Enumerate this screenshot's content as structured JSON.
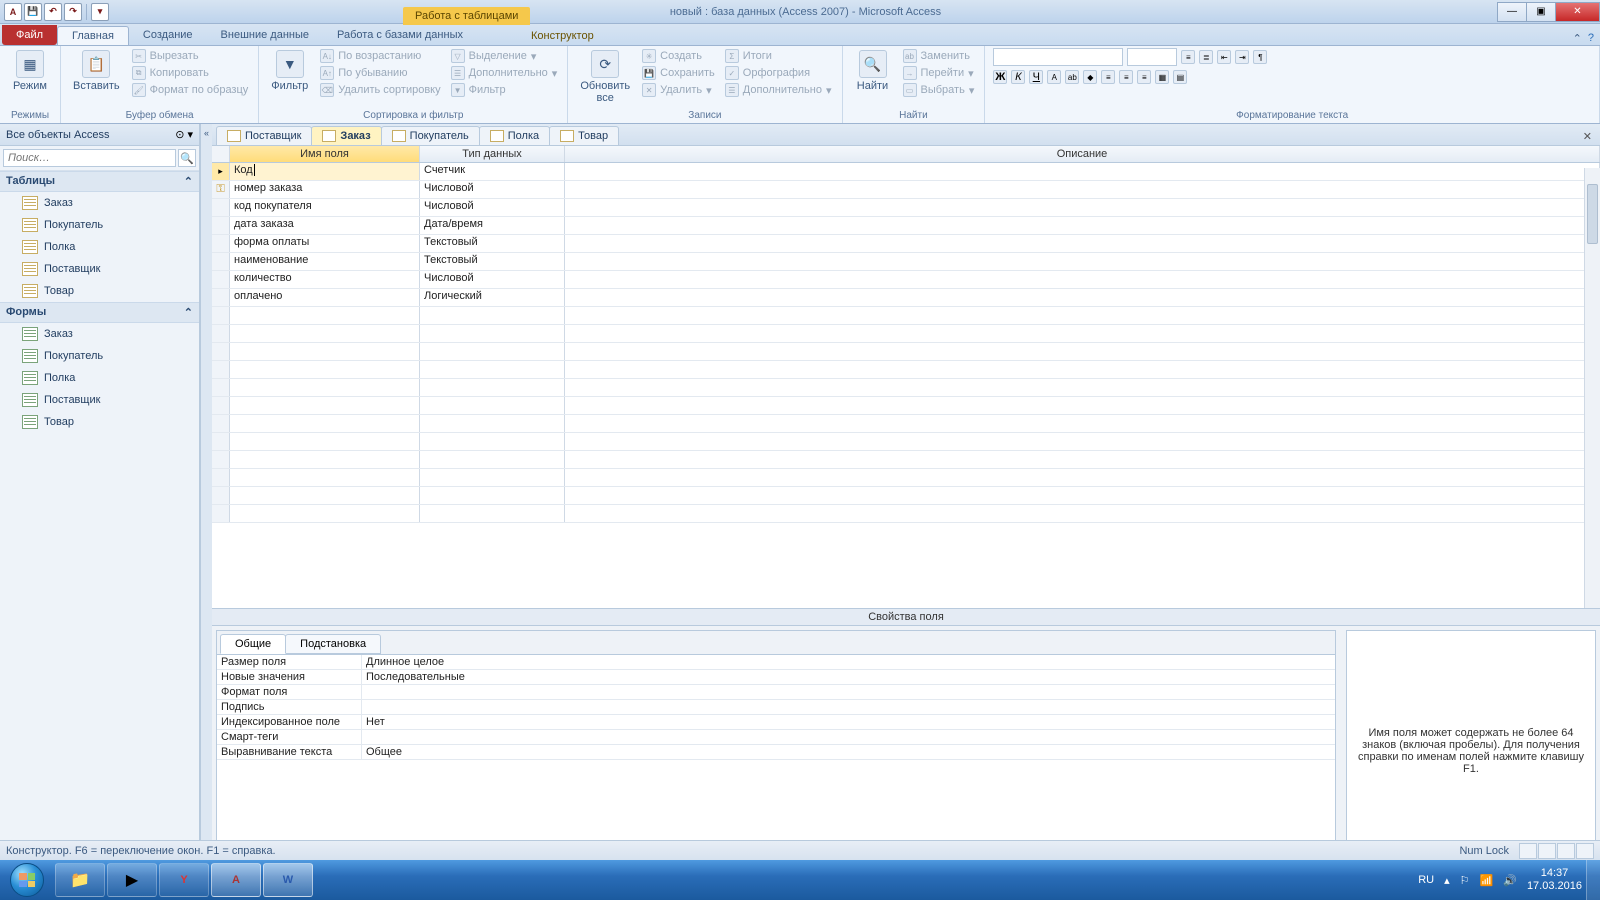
{
  "title": {
    "context": "Работа с таблицами",
    "doc": "новый : база данных (Access 2007)  -  Microsoft Access"
  },
  "qat": {
    "app": "A"
  },
  "tabs": {
    "file": "Файл",
    "list": [
      "Главная",
      "Создание",
      "Внешние данные",
      "Работа с базами данных"
    ],
    "context": "Конструктор"
  },
  "ribbon": {
    "g1": {
      "label": "Режимы",
      "btn": "Режим"
    },
    "g2": {
      "label": "Буфер обмена",
      "btn": "Вставить",
      "cut": "Вырезать",
      "copy": "Копировать",
      "fmt": "Формат по образцу"
    },
    "g3": {
      "label": "Сортировка и фильтр",
      "btn": "Фильтр",
      "asc": "По возрастанию",
      "desc": "По убыванию",
      "clr": "Удалить сортировку",
      "sel": "Выделение",
      "adv": "Дополнительно",
      "flt": "Фильтр"
    },
    "g4": {
      "label": "Записи",
      "btn": "Обновить\nвсе",
      "new": "Создать",
      "save": "Сохранить",
      "del": "Удалить",
      "tot": "Итоги",
      "spl": "Орфография",
      "more": "Дополнительно"
    },
    "g5": {
      "label": "Найти",
      "btn": "Найти",
      "repl": "Заменить",
      "goto": "Перейти",
      "sel": "Выбрать"
    },
    "g6": {
      "label": "Форматирование текста"
    }
  },
  "nav": {
    "title": "Все объекты Access",
    "search": "Поиск…",
    "tables_h": "Таблицы",
    "tables": [
      "Заказ",
      "Покупатель",
      "Полка",
      "Поставщик",
      "Товар"
    ],
    "forms_h": "Формы",
    "forms": [
      "Заказ",
      "Покупатель",
      "Полка",
      "Поставщик",
      "Товар"
    ]
  },
  "doctabs": [
    "Поставщик",
    "Заказ",
    "Покупатель",
    "Полка",
    "Товар"
  ],
  "doctab_active": 1,
  "grid": {
    "cols": [
      "Имя поля",
      "Тип данных",
      "Описание"
    ],
    "rows": [
      {
        "name": "Код",
        "type": "Счетчик",
        "active": true
      },
      {
        "name": "номер заказа",
        "type": "Числовой",
        "key": true
      },
      {
        "name": "код покупателя",
        "type": "Числовой"
      },
      {
        "name": "дата заказа",
        "type": "Дата/время"
      },
      {
        "name": "форма оплаты",
        "type": "Текстовый"
      },
      {
        "name": "наименование",
        "type": "Текстовый"
      },
      {
        "name": "количество",
        "type": "Числовой"
      },
      {
        "name": "оплачено",
        "type": "Логический"
      }
    ]
  },
  "props": {
    "title": "Свойства поля",
    "tabs": [
      "Общие",
      "Подстановка"
    ],
    "rows": [
      {
        "k": "Размер поля",
        "v": "Длинное целое"
      },
      {
        "k": "Новые значения",
        "v": "Последовательные"
      },
      {
        "k": "Формат поля",
        "v": ""
      },
      {
        "k": "Подпись",
        "v": ""
      },
      {
        "k": "Индексированное поле",
        "v": "Нет"
      },
      {
        "k": "Смарт-теги",
        "v": ""
      },
      {
        "k": "Выравнивание текста",
        "v": "Общее"
      }
    ],
    "help": "Имя поля может содержать не более 64 знаков (включая пробелы). Для получения справки по именам полей нажмите клавишу F1."
  },
  "status": {
    "left": "Конструктор.  F6 = переключение окон.  F1 = справка.",
    "numlock": "Num Lock"
  },
  "taskbar": {
    "lang": "RU",
    "time": "14:37",
    "date": "17.03.2016"
  }
}
